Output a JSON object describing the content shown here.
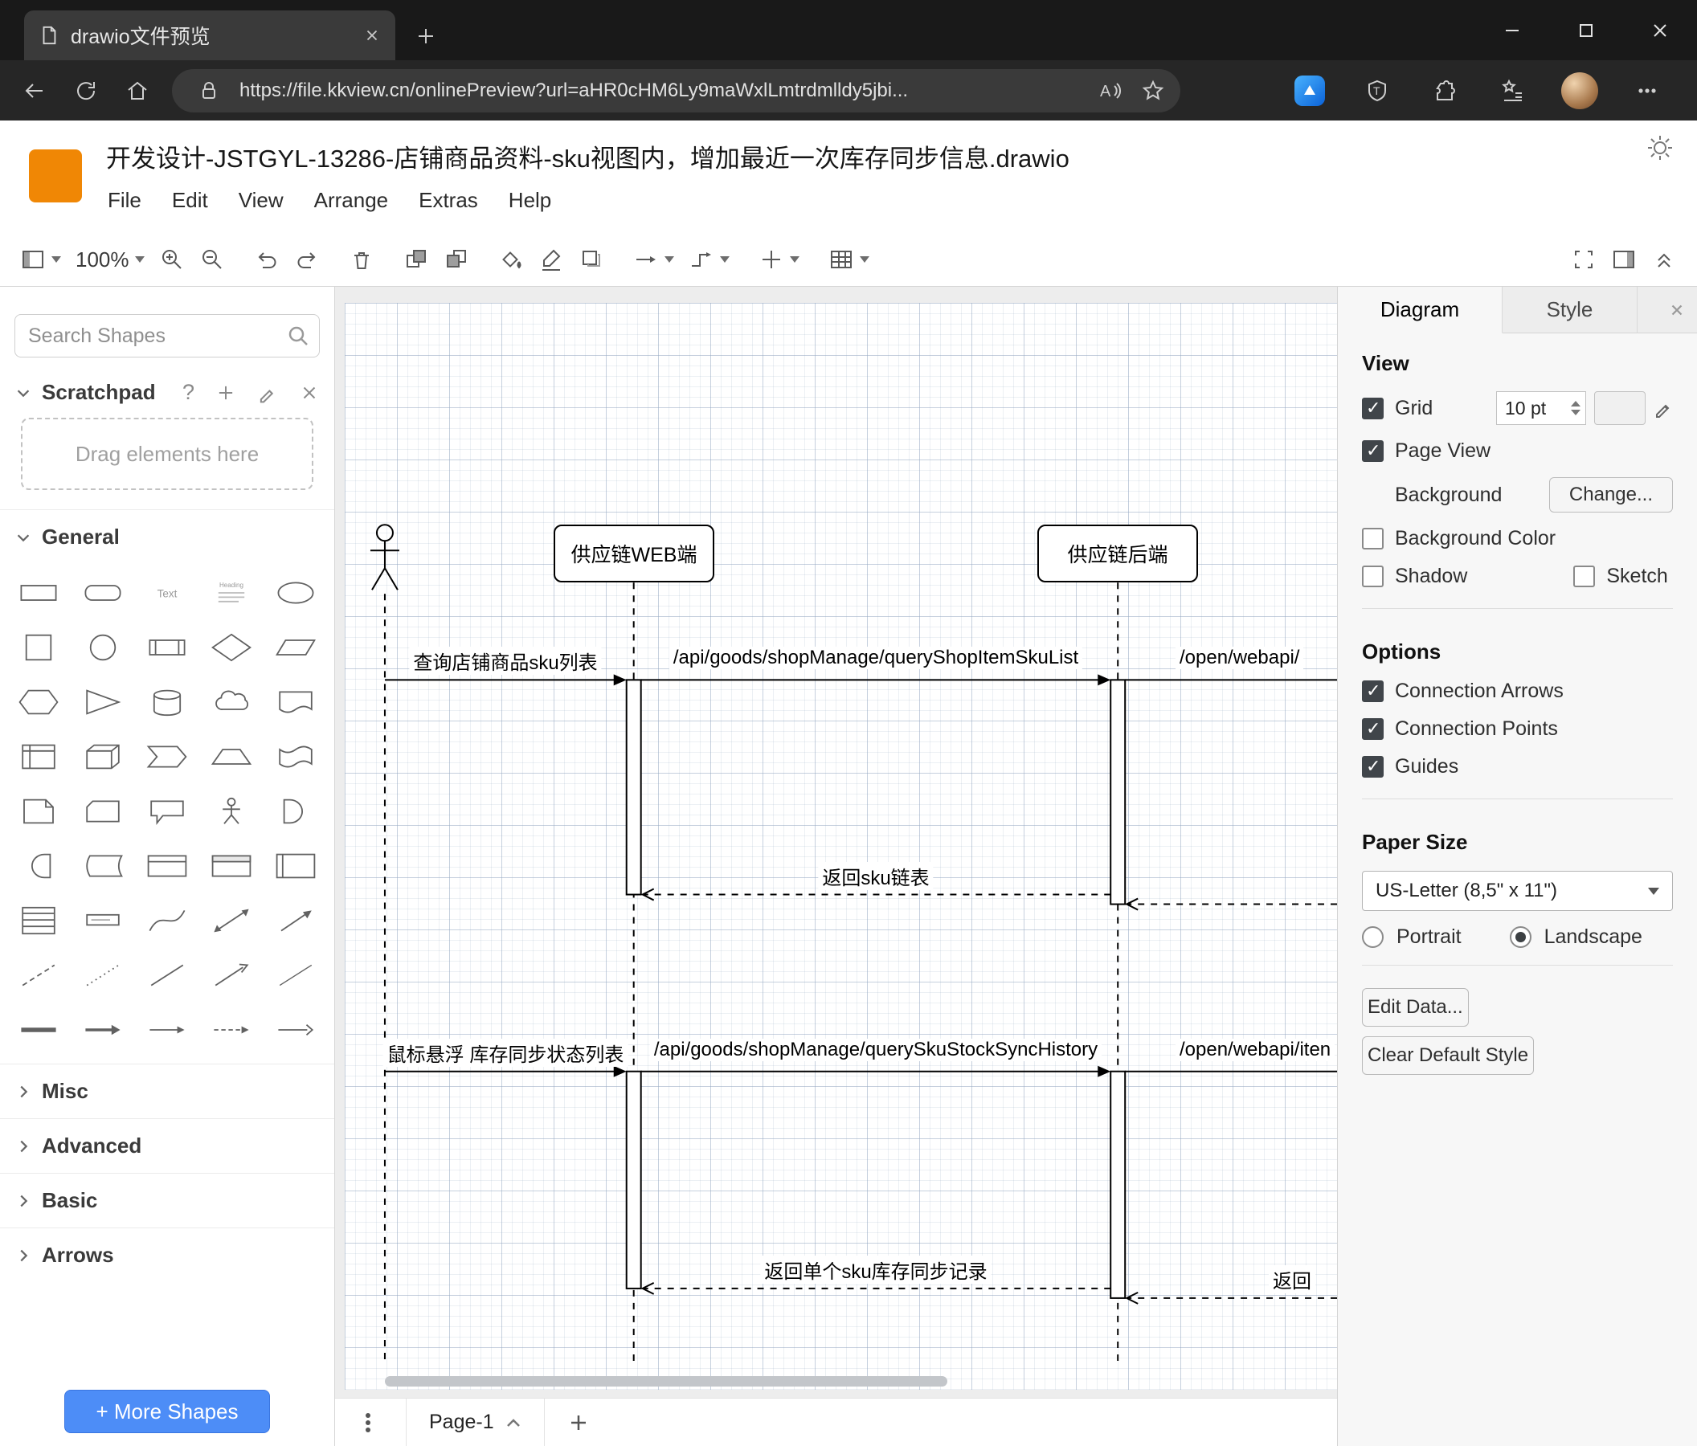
{
  "colors": {
    "logo_orange": "#f08705",
    "more_shapes_blue": "#4d8df7",
    "checkbox_accent": "#40454a"
  },
  "browser": {
    "tab_title": "drawio文件预览",
    "url": "https://file.kkview.cn/onlinePreview?url=aHR0cHM6Ly9maWxlLmtrdmlldy5jbi...",
    "nav_icons": [
      "back",
      "refresh",
      "home"
    ],
    "pill_leading_icons": [
      "lock"
    ],
    "pill_trailing_icons": [
      "read-aloud",
      "add-favorite"
    ],
    "extension_icons": [
      "copilot",
      "tampermonkey",
      "extensions",
      "favorites-hub",
      "profile-avatar",
      "settings"
    ],
    "window_controls": [
      "minimize",
      "maximize",
      "close-window"
    ]
  },
  "app": {
    "title": "开发设计-JSTGYL-13286-店铺商品资料-sku视图内，增加最近一次库存同步信息.drawio",
    "menu": [
      "File",
      "Edit",
      "View",
      "Arrange",
      "Extras",
      "Help"
    ],
    "toolbar": {
      "zoom": "100%",
      "left": [
        "view-selector",
        "zoom-dropdown",
        "zoom-in",
        "zoom-out",
        "|",
        "undo",
        "redo",
        "|",
        "delete",
        "|",
        "to-front",
        "to-back",
        "|",
        "fill-color",
        "line-color",
        "shadow",
        "|",
        "connection-style",
        "waypoint-style",
        "|",
        "insert",
        "|",
        "table"
      ],
      "right": [
        "fullscreen",
        "format-panel",
        "collapse-toolbar"
      ]
    }
  },
  "sidebar": {
    "search_placeholder": "Search Shapes",
    "scratchpad_label": "Scratchpad",
    "scratchpad_icons": [
      "help",
      "add",
      "edit",
      "close"
    ],
    "scratchpad_hint": "Drag elements here",
    "section_general": "General",
    "sections_collapsed": [
      "Misc",
      "Advanced",
      "Basic",
      "Arrows"
    ],
    "shapes": [
      "rectangle",
      "rounded-rectangle",
      "text",
      "textbox",
      "ellipse",
      "square",
      "circle",
      "process",
      "diamond",
      "parallelogram",
      "hexagon",
      "triangle",
      "cylinder",
      "cloud",
      "document",
      "internal-storage",
      "cube",
      "step",
      "trapezoid",
      "tape",
      "note",
      "card",
      "callout",
      "actor",
      "or",
      "and",
      "data-storage",
      "container",
      "container-title",
      "container-vertical",
      "list",
      "list-item",
      "curve",
      "bidirectional-arrow",
      "arrow",
      "dashed-line",
      "dotted-line",
      "line",
      "directional-arrow",
      "diagonal-line",
      "link",
      "arrow-solid",
      "arrow-thin",
      "arrow-dashed",
      "arrow-open"
    ],
    "more_shapes_label": "+ More Shapes"
  },
  "diagram": {
    "lifelines": [
      {
        "label": "供应链WEB端"
      },
      {
        "label": "供应链后端"
      }
    ],
    "messages": [
      {
        "label": "查询店铺商品sku列表",
        "type": "sync"
      },
      {
        "label": "/api/goods/shopManage/queryShopItemSkuList",
        "type": "sync"
      },
      {
        "label": "/open/webapi/",
        "type": "sync"
      },
      {
        "label": "返回sku链表",
        "type": "return"
      },
      {
        "label": "鼠标悬浮 库存同步状态列表",
        "type": "sync"
      },
      {
        "label": "/api/goods/shopManage/querySkuStockSyncHistory",
        "type": "sync"
      },
      {
        "label": "/open/webapi/iten",
        "type": "sync"
      },
      {
        "label": "返回单个sku库存同步记录",
        "type": "return"
      },
      {
        "label": "返回",
        "type": "return"
      }
    ]
  },
  "panel": {
    "tabs": [
      {
        "label": "Diagram",
        "active": true
      },
      {
        "label": "Style",
        "active": false
      }
    ],
    "view": {
      "heading": "View",
      "grid": {
        "label": "Grid",
        "checked": true,
        "size": "10 pt"
      },
      "page_view": {
        "label": "Page View",
        "checked": true
      },
      "background": {
        "label": "Background",
        "button": "Change..."
      },
      "background_color": {
        "label": "Background Color",
        "checked": false
      },
      "shadow": {
        "label": "Shadow",
        "checked": false
      },
      "sketch": {
        "label": "Sketch",
        "checked": false
      }
    },
    "options": {
      "heading": "Options",
      "items": [
        {
          "label": "Connection Arrows",
          "checked": true
        },
        {
          "label": "Connection Points",
          "checked": true
        },
        {
          "label": "Guides",
          "checked": true
        }
      ]
    },
    "paper": {
      "heading": "Paper Size",
      "size": "US-Letter (8,5\" x 11\")",
      "orientation": [
        {
          "label": "Portrait",
          "selected": false
        },
        {
          "label": "Landscape",
          "selected": true
        }
      ]
    },
    "buttons": [
      "Edit Data...",
      "Clear Default Style"
    ]
  },
  "footer": {
    "page_tab": "Page-1"
  }
}
